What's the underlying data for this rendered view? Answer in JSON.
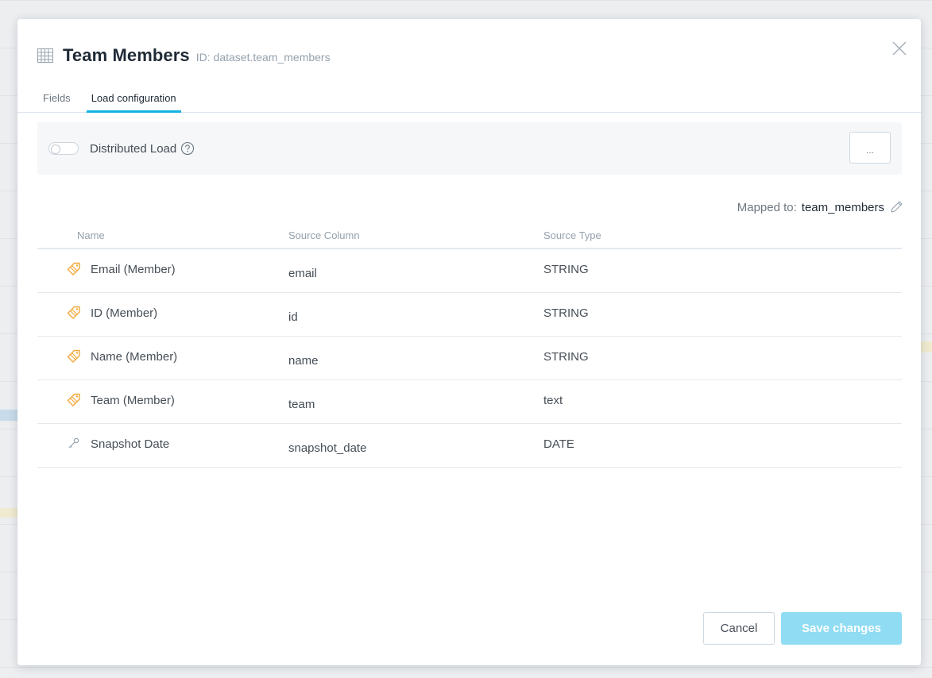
{
  "dataset": {
    "title": "Team Members",
    "id_text": "ID: dataset.team_members"
  },
  "tabs": [
    {
      "label": "Fields",
      "active": false
    },
    {
      "label": "Load configuration",
      "active": true
    }
  ],
  "config": {
    "distributed_label": "Distributed Load",
    "distributed_enabled": false,
    "more_label": "..."
  },
  "mapping": {
    "label": "Mapped to:",
    "value": "team_members"
  },
  "table": {
    "columns": [
      "Name",
      "Source Column",
      "Source Type"
    ],
    "rows": [
      {
        "name": "Email (Member)",
        "source": "email",
        "type": "STRING",
        "icon": "attribute-tag-icon"
      },
      {
        "name": "ID (Member)",
        "source": "id",
        "type": "STRING",
        "icon": "attribute-tag-icon"
      },
      {
        "name": "Name (Member)",
        "source": "name",
        "type": "STRING",
        "icon": "attribute-tag-icon"
      },
      {
        "name": "Team (Member)",
        "source": "team",
        "type": "text",
        "icon": "attribute-tag-icon"
      },
      {
        "name": "Snapshot Date",
        "source": "snapshot_date",
        "type": "DATE",
        "icon": "key-icon"
      }
    ]
  },
  "footer": {
    "cancel_label": "Cancel",
    "save_label": "Save changes"
  },
  "colors": {
    "accent": "#14b2e2",
    "save_disabled": "#8fdcf3",
    "attribute_icon": "#f3a83b"
  }
}
